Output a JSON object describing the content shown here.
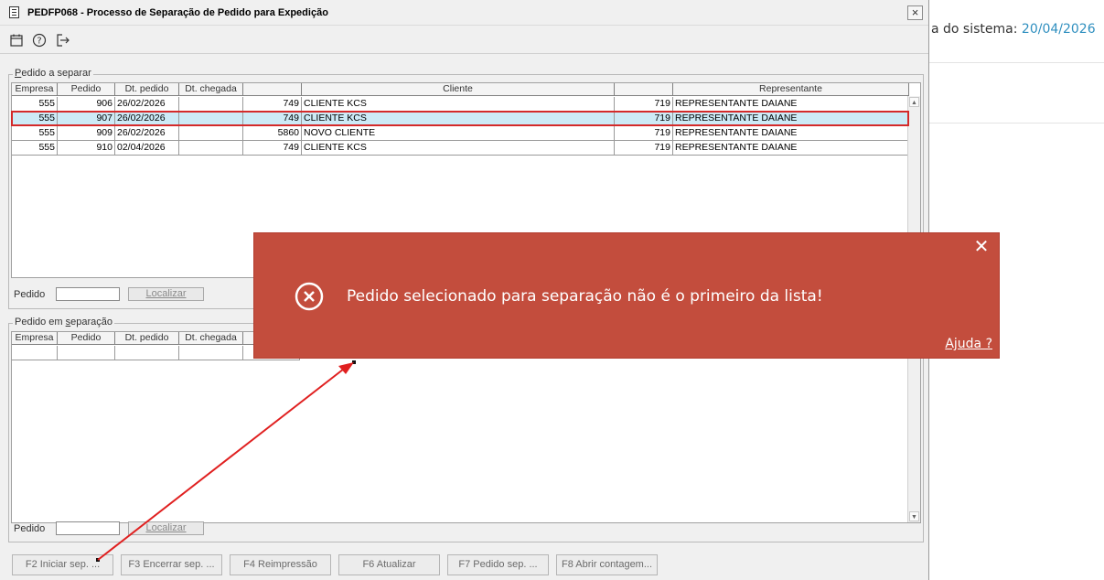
{
  "window": {
    "title": "PEDFP068 - Processo de Separação de Pedido para Expedição",
    "close_label": "×",
    "toolbar": [
      {
        "name": "calendar-icon",
        "glyph": "▦"
      },
      {
        "name": "help-icon",
        "glyph": "?"
      },
      {
        "name": "exit-icon",
        "glyph": "↦"
      }
    ]
  },
  "background": {
    "system_date_label": "a do sistema: ",
    "system_date_value": "20/04/2026"
  },
  "pedido_a_separar": {
    "title_underlined": "P",
    "title_rest": "edido a separar",
    "columns": [
      "Empresa",
      "Pedido",
      "Dt. pedido",
      "Dt. chegada",
      "",
      "Cliente",
      "",
      "Representante"
    ],
    "rows": [
      {
        "empresa": "555",
        "pedido": "906",
        "dt_pedido": "26/02/2026",
        "dt_chegada": "",
        "cod_cliente": "749",
        "cliente": "CLIENTE  KCS",
        "cod_rep": "719",
        "representante": "REPRESENTANTE DAIANE",
        "selected": false
      },
      {
        "empresa": "555",
        "pedido": "907",
        "dt_pedido": "26/02/2026",
        "dt_chegada": "",
        "cod_cliente": "749",
        "cliente": "CLIENTE  KCS",
        "cod_rep": "719",
        "representante": "REPRESENTANTE DAIANE",
        "selected": true
      },
      {
        "empresa": "555",
        "pedido": "909",
        "dt_pedido": "26/02/2026",
        "dt_chegada": "",
        "cod_cliente": "5860",
        "cliente": "NOVO CLIENTE",
        "cod_rep": "719",
        "representante": "REPRESENTANTE DAIANE",
        "selected": false
      },
      {
        "empresa": "555",
        "pedido": "910",
        "dt_pedido": "02/04/2026",
        "dt_chegada": "",
        "cod_cliente": "749",
        "cliente": "CLIENTE  KCS",
        "cod_rep": "719",
        "representante": "REPRESENTANTE DAIANE",
        "selected": false
      }
    ],
    "search_label": "Pedido",
    "search_value": "",
    "search_button": "Localizar"
  },
  "pedido_em_separacao": {
    "title_rest_1": "Pedido em ",
    "title_underlined": "s",
    "title_rest_2": "eparação",
    "columns": [
      "Empresa",
      "Pedido",
      "Dt. pedido",
      "Dt. chegada"
    ],
    "search_label": "Pedido",
    "search_value": "",
    "search_button": "Localizar"
  },
  "buttons": [
    {
      "name": "f2-iniciar-button",
      "label": "F2 Iniciar sep. ..."
    },
    {
      "name": "f3-encerrar-button",
      "label": "F3 Encerrar sep. ..."
    },
    {
      "name": "f4-reimpressao-button",
      "label": "F4 Reimpressão"
    },
    {
      "name": "f6-atualizar-button",
      "label": "F6 Atualizar"
    },
    {
      "name": "f7-pedido-button",
      "label": "F7 Pedido sep. ..."
    },
    {
      "name": "f8-abrir-contagem-button",
      "label": "F8 Abrir contagem..."
    }
  ],
  "toast": {
    "message": "Pedido selecionado para separação não é o primeiro da lista!",
    "help_link": "Ajuda ?",
    "close_label": "✕",
    "background_color": "#c34d3d"
  },
  "annotation": {
    "arrow_color": "#e02020",
    "highlight_color": "#d42a2a"
  }
}
